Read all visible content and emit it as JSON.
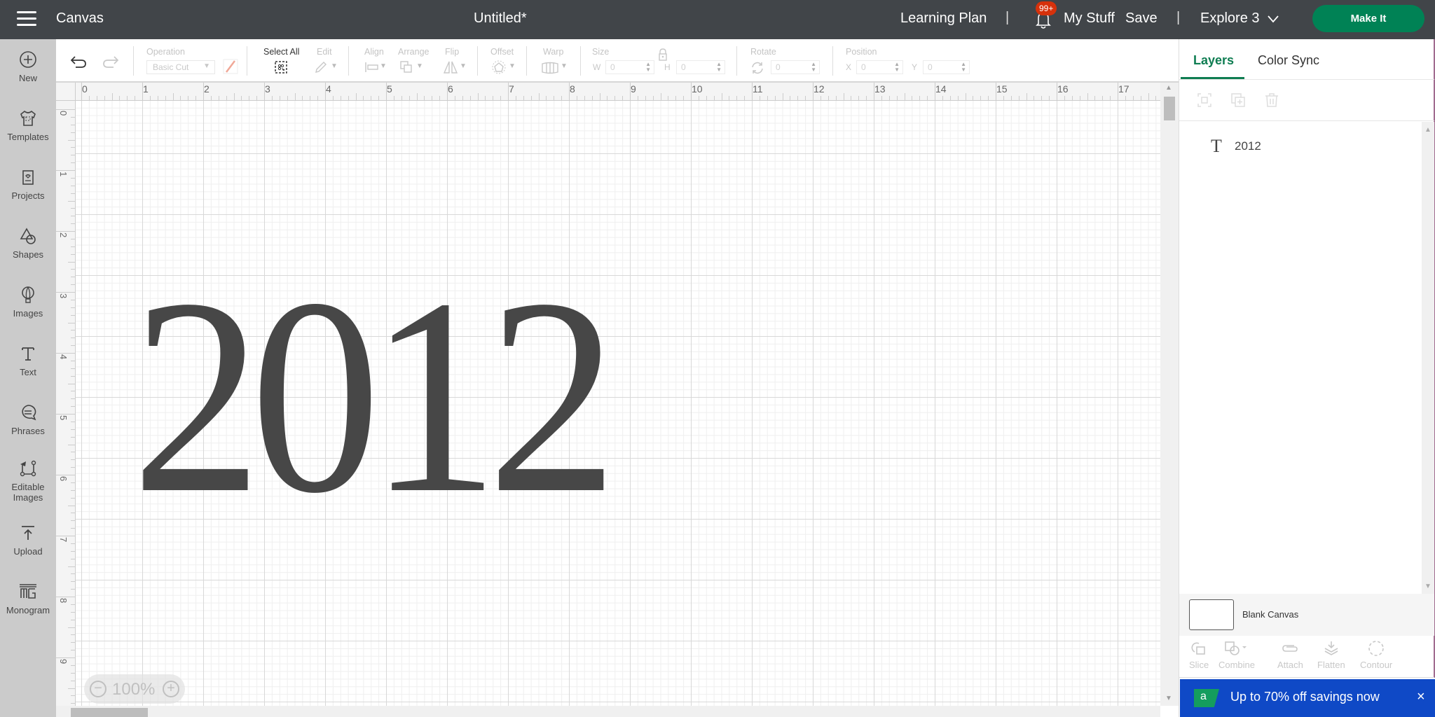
{
  "header": {
    "menu_icon": "hamburger-icon",
    "app_title": "Canvas",
    "doc_title": "Untitled*",
    "learning_plan": "Learning Plan",
    "separator": "|",
    "notification_badge": "99+",
    "my_stuff": "My Stuff",
    "save": "Save",
    "machine": "Explore 3",
    "make_it": "Make It",
    "colors": {
      "bar": "#414549",
      "make_it": "#008255",
      "badge": "#d6310b"
    }
  },
  "left_nav": {
    "items": [
      {
        "label": "New",
        "icon": "plus-circle-icon"
      },
      {
        "label": "Templates",
        "icon": "shirt-icon"
      },
      {
        "label": "Projects",
        "icon": "card-heart-icon"
      },
      {
        "label": "Shapes",
        "icon": "shapes-icon"
      },
      {
        "label": "Images",
        "icon": "balloon-icon"
      },
      {
        "label": "Text",
        "icon": "text-t-icon"
      },
      {
        "label": "Phrases",
        "icon": "speech-bubble-icon"
      },
      {
        "label": "Editable",
        "label2": "Images",
        "icon": "editable-images-icon"
      },
      {
        "label": "Upload",
        "icon": "upload-icon"
      },
      {
        "label": "Monogram",
        "icon": "monogram-icon"
      }
    ]
  },
  "toolbar": {
    "operation_label": "Operation",
    "operation_value": "Basic Cut",
    "select_all_label": "Select All",
    "edit_label": "Edit",
    "align_label": "Align",
    "arrange_label": "Arrange",
    "flip_label": "Flip",
    "offset_label": "Offset",
    "warp_label": "Warp",
    "size_label": "Size",
    "width_label": "W",
    "width_value": "0",
    "height_label": "H",
    "height_value": "0",
    "rotate_label": "Rotate",
    "rotate_value": "0",
    "position_label": "Position",
    "x_label": "X",
    "x_value": "0",
    "y_label": "Y",
    "y_value": "0"
  },
  "canvas": {
    "ruler_top": [
      "0",
      "1",
      "2",
      "3",
      "4",
      "5",
      "6",
      "7",
      "8",
      "9",
      "10",
      "11",
      "12",
      "13",
      "14",
      "15",
      "16",
      "17"
    ],
    "ruler_left": [
      "0",
      "1",
      "2",
      "3",
      "4",
      "5",
      "6",
      "7",
      "8",
      "9"
    ],
    "design_text": "2012",
    "design_color": "#474747",
    "zoom_level": "100%"
  },
  "right_panel": {
    "tabs": [
      {
        "label": "Layers",
        "active": true
      },
      {
        "label": "Color Sync",
        "active": false
      }
    ],
    "layer_actions": [
      "group-icon",
      "duplicate-icon",
      "delete-icon"
    ],
    "layers": [
      {
        "type": "text",
        "name": "2012"
      }
    ],
    "blank_canvas_label": "Blank Canvas",
    "bottom_actions": [
      {
        "label": "Slice",
        "icon": "slice-icon"
      },
      {
        "label": "Combine",
        "icon": "combine-icon"
      },
      {
        "label": "Attach",
        "icon": "attach-icon"
      },
      {
        "label": "Flatten",
        "icon": "flatten-icon"
      },
      {
        "label": "Contour",
        "icon": "contour-icon"
      }
    ],
    "accent": "#0f7d52"
  },
  "promo": {
    "message": "Up to 70% off savings now",
    "close": "×",
    "flag_glyph": "a",
    "color": "#0f49c6"
  }
}
